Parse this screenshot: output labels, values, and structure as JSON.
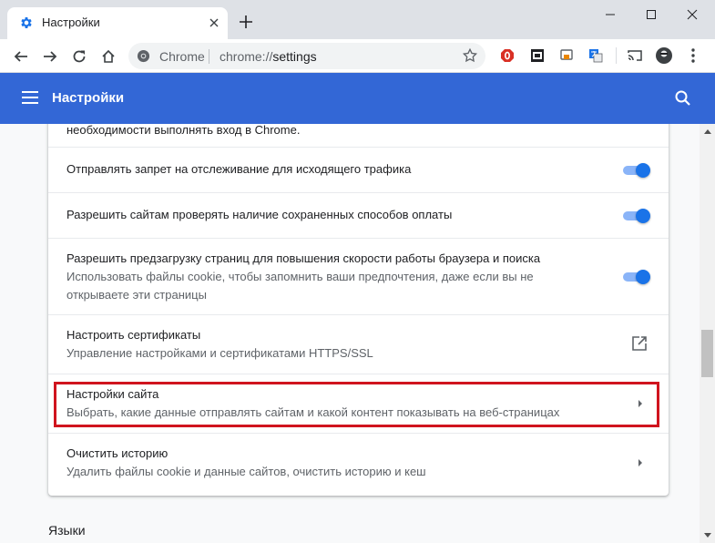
{
  "window": {
    "tab_title": "Настройки",
    "new_tab_label": "+"
  },
  "toolbar": {
    "omnibox_site": "Chrome",
    "omnibox_url_scheme": "chrome://",
    "omnibox_url_path": "settings"
  },
  "header": {
    "title": "Настройки"
  },
  "settings": {
    "partial_row_text": "необходимости выполнять вход в Chrome.",
    "rows": [
      {
        "primary": "Отправлять запрет на отслеживание для исходящего трафика",
        "control": "toggle",
        "enabled": true
      },
      {
        "primary": "Разрешить сайтам проверять наличие сохраненных способов оплаты",
        "control": "toggle",
        "enabled": true
      },
      {
        "primary": "Разрешить предзагрузку страниц для повышения скорости работы браузера и поиска",
        "secondary_line1": "Использовать файлы cookie, чтобы запомнить ваши предпочтения, даже если вы не",
        "secondary_line2": "открываете эти страницы",
        "control": "toggle",
        "enabled": true
      },
      {
        "primary": "Настроить сертификаты",
        "secondary": "Управление настройками и сертификатами HTTPS/SSL",
        "control": "external-link-icon"
      },
      {
        "primary": "Настройки сайта",
        "secondary": "Выбрать, какие данные отправлять сайтам и какой контент показывать на веб-страницах",
        "control": "chevron-right-icon",
        "highlighted": true
      },
      {
        "primary": "Очистить историю",
        "secondary": "Удалить файлы cookie и данные сайтов, очистить историю и кеш",
        "control": "chevron-right-icon"
      }
    ],
    "next_section_title": "Языки"
  },
  "colors": {
    "header_blue": "#3367d6",
    "toggle_on": "#1a73e8",
    "highlight_red": "#d0141e"
  }
}
